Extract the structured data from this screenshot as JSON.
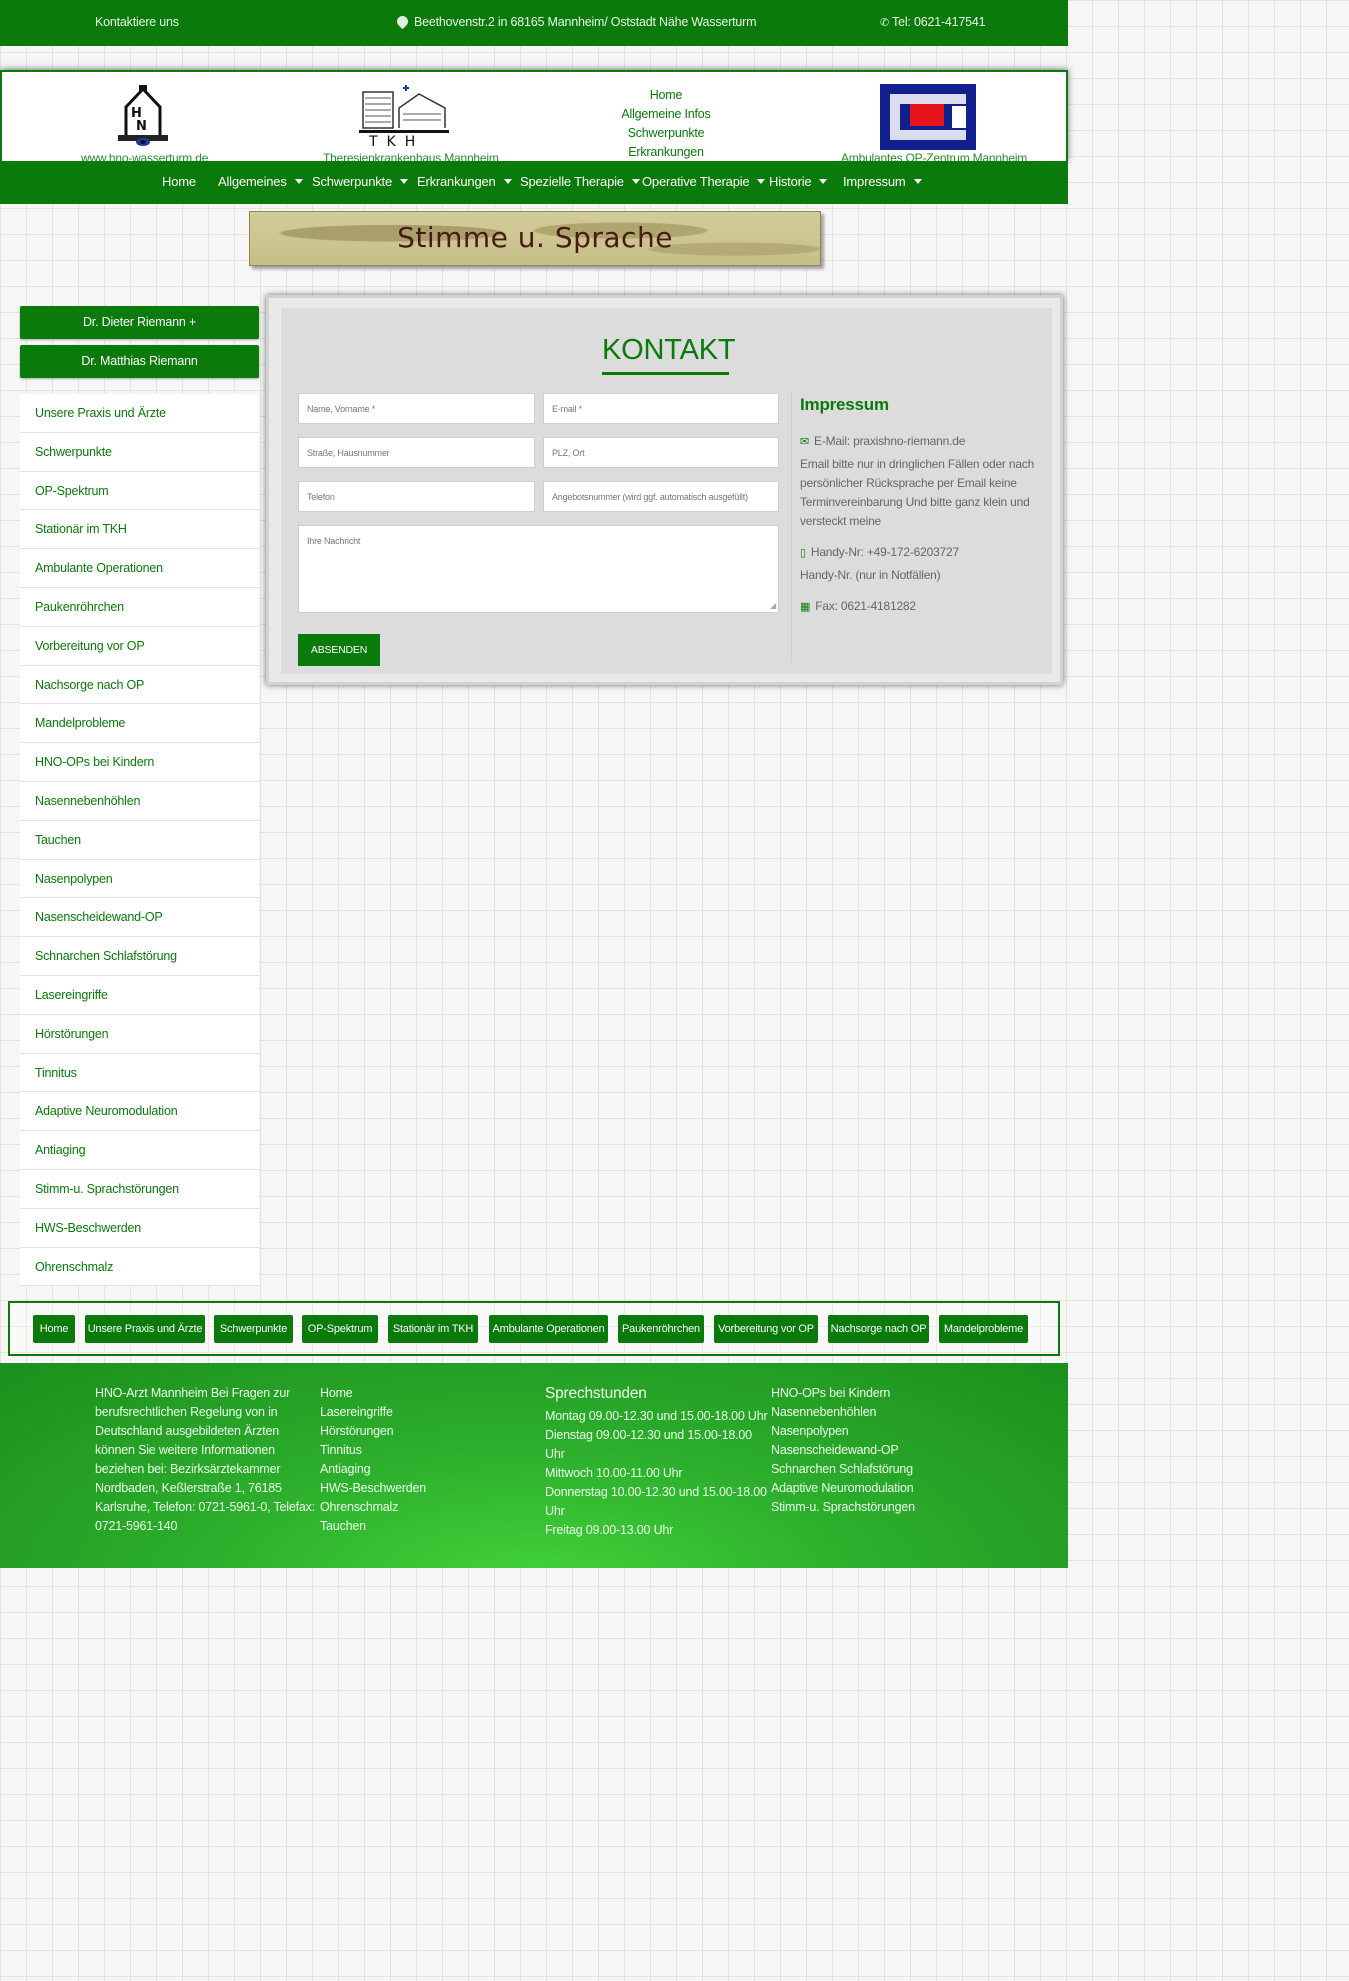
{
  "topbar": {
    "contact": "Kontaktiere uns",
    "address": "Beethovenstr.2 in 68165 Mannheim/ Oststadt Nähe Wasserturm",
    "phone": "Tel: 0621-417541"
  },
  "header": {
    "logo1_caption": "www.hno-wasserturm.de",
    "logo2_caption": "Theresienkrankenhaus Mannheim",
    "logo2_text": "TKH",
    "logo3_caption": "Ambulantes OP-Zentrum Mannheim",
    "center_links": [
      "Home",
      "Allgemeine Infos",
      "Schwerpunkte",
      "Erkrankungen"
    ]
  },
  "nav": {
    "items": [
      {
        "label": "Home"
      },
      {
        "label": "Allgemeines"
      },
      {
        "label": "Schwerpunkte"
      },
      {
        "label": "Erkrankungen"
      },
      {
        "label": "Spezielle Therapie"
      },
      {
        "label": "Operative Therapie"
      },
      {
        "label": "Historie"
      },
      {
        "label": "Impressum"
      }
    ]
  },
  "banner": {
    "text": "Stimme u. Sprache"
  },
  "sidebar": {
    "buttons": [
      "Dr. Dieter Riemann +",
      "Dr. Matthias Riemann"
    ],
    "items": [
      "Unsere Praxis und Ärzte",
      "Schwerpunkte",
      "OP-Spektrum",
      "Stationär im TKH",
      "Ambulante Operationen",
      "Paukenröhrchen",
      "Vorbereitung vor OP",
      "Nachsorge nach OP",
      "Mandelprobleme",
      "HNO-OPs bei Kindern",
      "Nasennebenhöhlen",
      "Tauchen",
      "Nasenpolypen",
      "Nasenscheidewand-OP",
      "Schnarchen Schlafstörung",
      "Lasereingriffe",
      "Hörstörungen",
      "Tinnitus",
      "Adaptive Neuromodulation",
      "Antiaging",
      "Stimm-u. Sprachstörungen",
      "HWS-Beschwerden",
      "Ohrenschmalz"
    ]
  },
  "contact": {
    "title": "KONTAKT",
    "fields": {
      "name": "Name, Vorname *",
      "email": "E-mail *",
      "street": "Straße, Hausnummer",
      "city": "PLZ, Ort",
      "phone": "Telefon",
      "offer": "Angebotsnummer (wird ggf. automatisch ausgefüllt)",
      "message": "Ihre Nachricht"
    },
    "submit": "ABSENDEN"
  },
  "impressum": {
    "title": "Impressum",
    "email": "E-Mail: praxishno-riemann.de",
    "email_note": "Email bitte nur in dringlichen Fällen oder nach persönlicher Rücksprache per Email keine Terminvereinbarung Und bitte ganz klein und versteckt meine",
    "mobile": "Handy-Nr: +49-172-6203727",
    "mobile_note": "Handy-Nr. (nur in Notfällen)",
    "fax": "Fax: 0621-4181282"
  },
  "bottom_nav": [
    "Home",
    "Unsere Praxis und Ärzte",
    "Schwerpunkte",
    "OP-Spektrum",
    "Stationär im TKH",
    "Ambulante Operationen",
    "Paukenröhrchen",
    "Vorbereitung vor OP",
    "Nachsorge nach OP",
    "Mandelprobleme"
  ],
  "footer": {
    "about_lines": [
      "HNO-Arzt Mannheim Bei Fragen zur",
      "berufsrechtlichen Regelung von in",
      "Deutschland ausgebildeten Ärzten",
      "können Sie weitere Informationen",
      "beziehen bei: Bezirksärztekammer",
      "Nordbaden, Keßlerstraße 1, 76185",
      "Karlsruhe, Telefon: 0721-5961-0, Telefax:",
      "0721-5961-140"
    ],
    "links1": [
      "Home",
      "Lasereingriffe",
      "Hörstörungen",
      "Tinnitus",
      "Antiaging",
      "HWS-Beschwerden",
      "Ohrenschmalz",
      "Tauchen"
    ],
    "hours_title": "Sprechstunden",
    "hours_lines": [
      "Montag 09.00-12.30 und 15.00-18.00 Uhr",
      "Dienstag 09.00-12.30 und 15.00-18.00",
      "Uhr",
      "Mittwoch 10.00-11.00 Uhr",
      "Donnerstag 10.00-12.30 und 15.00-18.00",
      "Uhr",
      "Freitag 09.00-13.00 Uhr"
    ],
    "links2": [
      "HNO-OPs bei Kindern",
      "Nasennebenhöhlen",
      "Nasenpolypen",
      "Nasenscheidewand-OP",
      "Schnarchen Schlafstörung",
      "Adaptive Neuromodulation",
      "Stimm-u. Sprachstörungen"
    ]
  },
  "colors": {
    "primary": "#0a7a0a",
    "footer": "#2cae2c"
  }
}
